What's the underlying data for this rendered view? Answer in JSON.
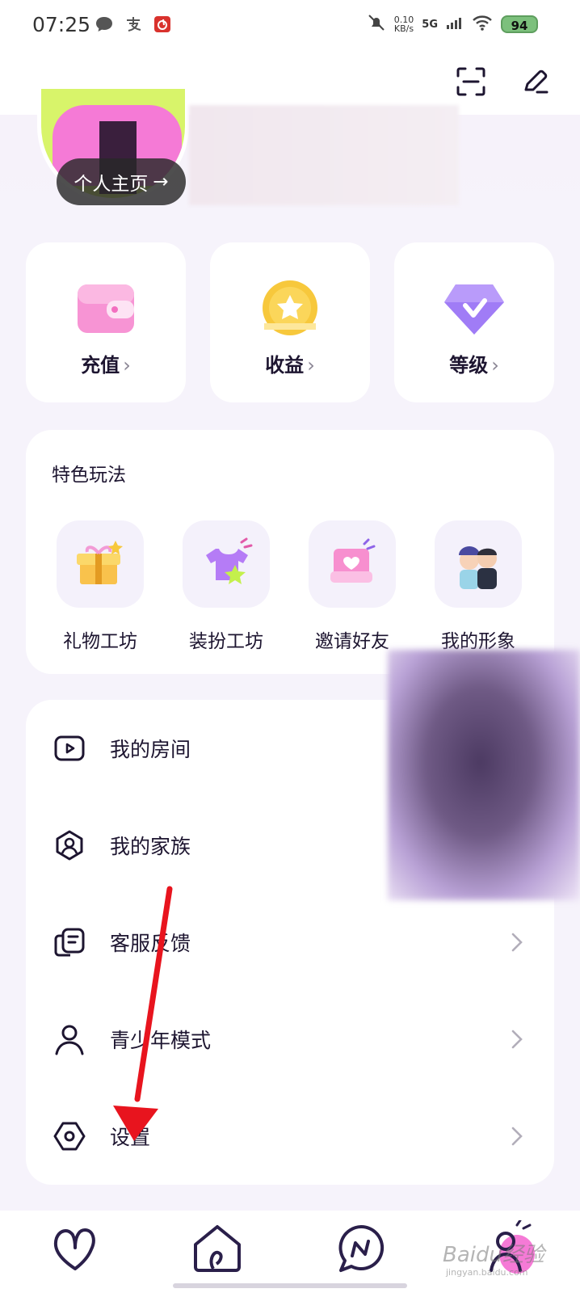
{
  "status_bar": {
    "time": "07:25",
    "net_speed_value": "0.10",
    "net_speed_unit": "KB/s",
    "network": "5G",
    "battery": "94"
  },
  "profile": {
    "home_label": "个人主页",
    "home_arrow": "→"
  },
  "stats": [
    {
      "label": "充值",
      "icon": "wallet-icon",
      "color": "#f36fc0"
    },
    {
      "label": "收益",
      "icon": "coin-star-icon",
      "color": "#f5c63b"
    },
    {
      "label": "等级",
      "icon": "diamond-badge-icon",
      "color": "#9b72f2"
    }
  ],
  "features": {
    "title": "特色玩法",
    "items": [
      {
        "label": "礼物工坊",
        "icon": "gift-icon"
      },
      {
        "label": "装扮工坊",
        "icon": "tshirt-icon"
      },
      {
        "label": "邀请好友",
        "icon": "invite-heart-icon"
      },
      {
        "label": "我的形象",
        "icon": "avatar-couple-icon"
      }
    ]
  },
  "menu": [
    {
      "label": "我的房间",
      "icon": "room-icon",
      "chevron": false
    },
    {
      "label": "我的家族",
      "icon": "family-icon",
      "chevron": false
    },
    {
      "label": "客服反馈",
      "icon": "feedback-icon",
      "chevron": true
    },
    {
      "label": "青少年模式",
      "icon": "teen-mode-icon",
      "chevron": true
    },
    {
      "label": "设置",
      "icon": "settings-icon",
      "chevron": true
    }
  ],
  "bottom_nav": [
    "heart-icon",
    "home-icon",
    "message-icon",
    "profile-icon"
  ],
  "chevron": "›",
  "watermark": "Baidu经验",
  "watermark_sub": "jingyan.baidu.com"
}
